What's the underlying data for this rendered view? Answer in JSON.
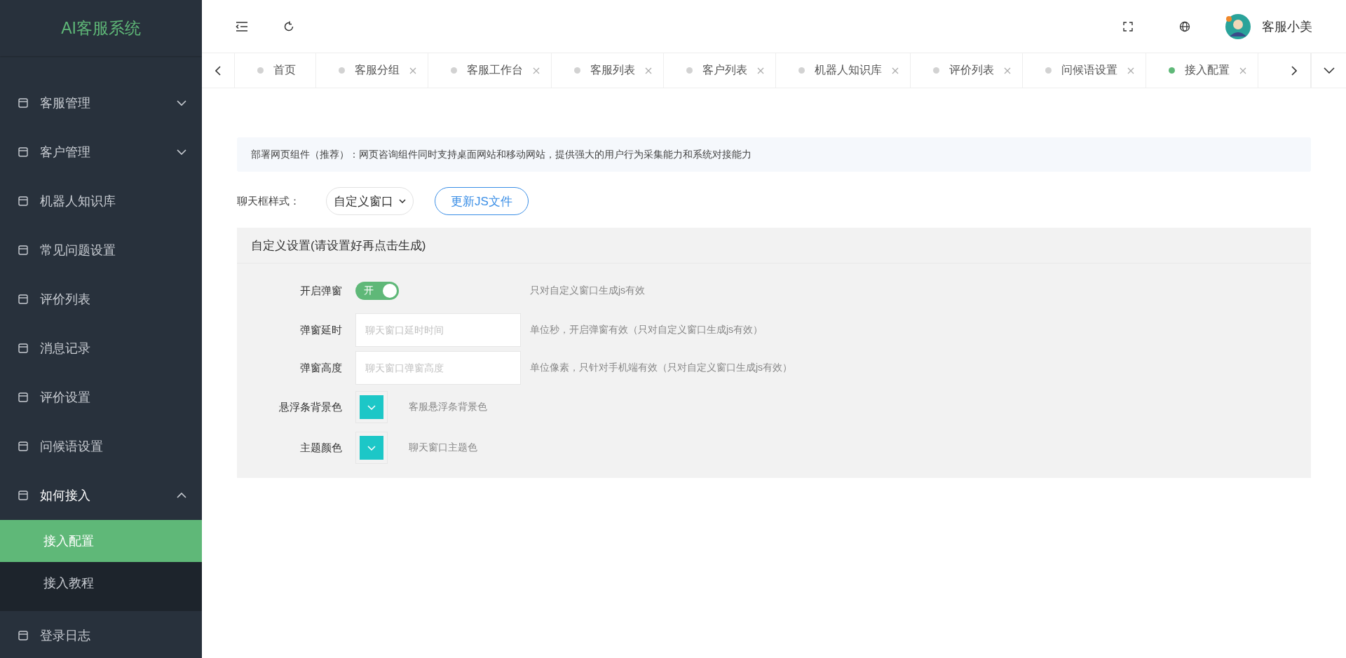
{
  "sidebar": {
    "logo": "AI客服系统",
    "items": [
      {
        "label": "客服管理",
        "expanded": false
      },
      {
        "label": "客户管理",
        "expanded": false
      },
      {
        "label": "机器人知识库"
      },
      {
        "label": "常见问题设置"
      },
      {
        "label": "评价列表"
      },
      {
        "label": "消息记录"
      },
      {
        "label": "评价设置"
      },
      {
        "label": "问候语设置"
      },
      {
        "label": "如何接入",
        "expanded": true,
        "children": [
          {
            "label": "接入配置",
            "selected": true
          },
          {
            "label": "接入教程",
            "selected": false
          }
        ]
      },
      {
        "label": "登录日志"
      }
    ]
  },
  "header": {
    "user": "客服小美"
  },
  "tabs": [
    {
      "label": "首页",
      "selected": false,
      "closable": false
    },
    {
      "label": "客服分组",
      "selected": false,
      "closable": true
    },
    {
      "label": "客服工作台",
      "selected": false,
      "closable": true
    },
    {
      "label": "客服列表",
      "selected": false,
      "closable": true
    },
    {
      "label": "客户列表",
      "selected": false,
      "closable": true
    },
    {
      "label": "机器人知识库",
      "selected": false,
      "closable": true
    },
    {
      "label": "评价列表",
      "selected": false,
      "closable": true
    },
    {
      "label": "问候语设置",
      "selected": false,
      "closable": true
    },
    {
      "label": "接入配置",
      "selected": true,
      "closable": true
    }
  ],
  "notice": "部署网页组件（推荐）：网页咨询组件同时支持桌面网站和移动网站，提供强大的用户行为采集能力和系统对接能力",
  "style_row": {
    "label": "聊天框样式：",
    "value": "自定义窗口",
    "button": "更新JS文件"
  },
  "panel": {
    "title": "自定义设置(请设置好再点击生成)",
    "rows": [
      {
        "kind": "toggle",
        "label": "开启弹窗",
        "on": true,
        "toggle_text": "开",
        "hint": "只对自定义窗口生成js有效"
      },
      {
        "kind": "input",
        "label": "弹窗延时",
        "placeholder": "聊天窗口延时时间",
        "hint": "单位秒，开启弹窗有效（只对自定义窗口生成js有效）"
      },
      {
        "kind": "input",
        "label": "弹窗高度",
        "placeholder": "聊天窗口弹窗高度",
        "hint": "单位像素，只针对手机端有效（只对自定义窗口生成js有效）"
      },
      {
        "kind": "color",
        "label": "悬浮条背景色",
        "color": "#1cc7c7",
        "hint": "客服悬浮条背景色"
      },
      {
        "kind": "color",
        "label": "主题颜色",
        "color": "#1cc7c7",
        "hint": "聊天窗口主题色"
      }
    ]
  }
}
